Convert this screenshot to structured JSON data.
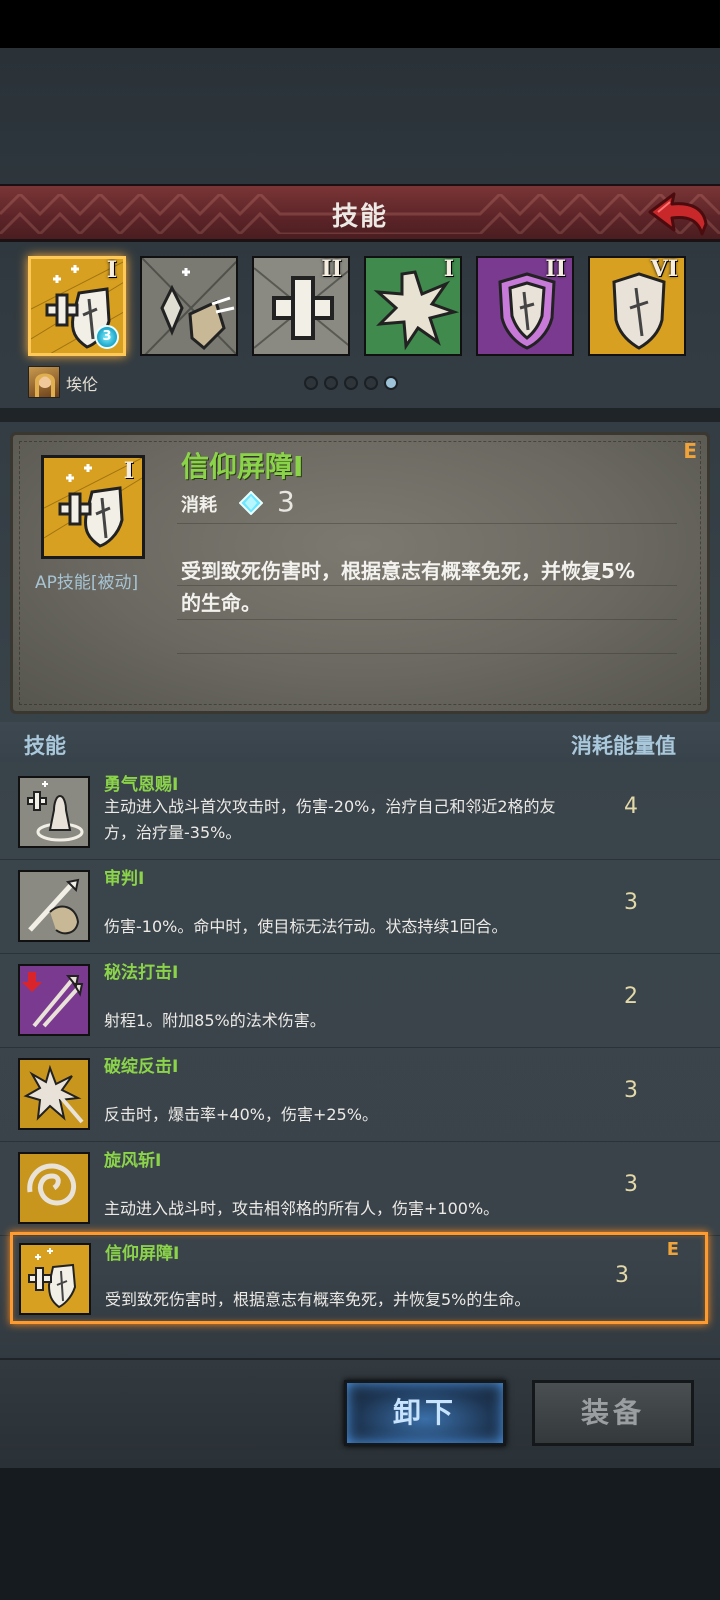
{
  "header": {
    "title": "技能"
  },
  "slots": [
    {
      "icon": "faith-barrier-icon",
      "numeral": "I",
      "color": "#d8a020",
      "badge": "3"
    },
    {
      "icon": "crystal-claw-icon",
      "numeral": "",
      "color": "#8a8a82"
    },
    {
      "icon": "holy-cross-icon",
      "numeral": "II",
      "color": "#8a8a82"
    },
    {
      "icon": "burst-star-icon",
      "numeral": "I",
      "color": "#3f8a4c"
    },
    {
      "icon": "purple-shield-icon",
      "numeral": "II",
      "color": "#7a3a90"
    },
    {
      "icon": "gold-shield-icon",
      "numeral": "VI",
      "color": "#d8a020"
    }
  ],
  "hero": {
    "name": "埃伦"
  },
  "pager": {
    "count": 5,
    "active": 4
  },
  "detail": {
    "grade": "E",
    "numeral": "I",
    "type": "AP技能[被动]",
    "name": "信仰屏障I",
    "cost_label": "消耗",
    "cost": "3",
    "desc": "受到致死伤害时，根据意志有概率免死，并恢复5%的生命。"
  },
  "list": {
    "header_left": "技能",
    "header_right": "消耗能量值",
    "items": [
      {
        "name": "勇气恩赐I",
        "desc": "主动进入战斗首次攻击时，伤害-20%，治疗自己和邻近2格的友方，治疗量-35%。",
        "cost": "4",
        "icon": "courage-gift-icon"
      },
      {
        "name": "审判I",
        "desc": "伤害-10%。命中时，使目标无法行动。状态持续1回合。",
        "cost": "3",
        "icon": "judgment-icon"
      },
      {
        "name": "秘法打击I",
        "desc": "射程1。附加85%的法术伤害。",
        "cost": "2",
        "icon": "arcane-strike-icon"
      },
      {
        "name": "破绽反击I",
        "desc": "反击时，爆击率+40%，伤害+25%。",
        "cost": "3",
        "icon": "counter-strike-icon"
      },
      {
        "name": "旋风斩I",
        "desc": "主动进入战斗时，攻击相邻格的所有人，伤害+100%。",
        "cost": "3",
        "icon": "whirlwind-icon"
      },
      {
        "name": "信仰屏障I",
        "desc": "受到致死伤害时，根据意志有概率免死，并恢复5%的生命。",
        "cost": "3",
        "icon": "faith-barrier-icon",
        "grade": "E",
        "equipped": true
      }
    ]
  },
  "buttons": {
    "unequip": "卸下",
    "equip": "装备"
  }
}
